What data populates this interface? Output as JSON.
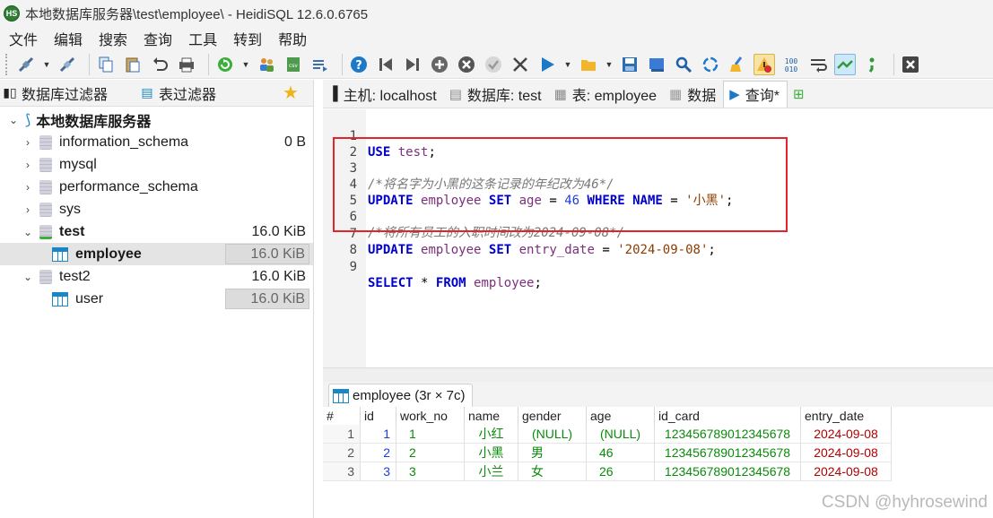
{
  "window": {
    "title": "本地数据库服务器\\test\\employee\\ - HeidiSQL 12.6.0.6765",
    "app_icon_text": "HS"
  },
  "menu": [
    "文件",
    "编辑",
    "搜索",
    "查询",
    "工具",
    "转到",
    "帮助"
  ],
  "filters": {
    "db_filter": "数据库过滤器",
    "table_filter": "表过滤器"
  },
  "tree": {
    "root": "本地数据库服务器",
    "nodes": [
      {
        "name": "information_schema",
        "size": "0 B"
      },
      {
        "name": "mysql",
        "size": ""
      },
      {
        "name": "performance_schema",
        "size": ""
      },
      {
        "name": "sys",
        "size": ""
      },
      {
        "name": "test",
        "size": "16.0 KiB"
      },
      {
        "name": "employee",
        "size": "16.0 KiB"
      },
      {
        "name": "test2",
        "size": "16.0 KiB"
      },
      {
        "name": "user",
        "size": "16.0 KiB"
      }
    ]
  },
  "tabs": {
    "host": "主机: localhost",
    "database": "数据库: test",
    "table": "表: employee",
    "data": "数据",
    "query": "查询*"
  },
  "editor": {
    "line_numbers": [
      "1",
      "2",
      "3",
      "4",
      "5",
      "6",
      "7",
      "8",
      "9"
    ],
    "comment1": "/*将名字为小黑的这条记录的年纪改为46*/",
    "comment2": "/*将所有员工的入职时间改为2024-09-08*/",
    "l1_kw": "USE",
    "l1_ident": "test",
    "l4_update": "UPDATE",
    "l4_table": "employee",
    "l4_set": "SET",
    "l4_col": "age",
    "l4_eq1": "=",
    "l4_val": "46",
    "l4_where": "WHERE",
    "l4_name": "NAME",
    "l4_eq2": "=",
    "l4_str": "'小黑'",
    "l7_update": "UPDATE",
    "l7_table": "employee",
    "l7_set": "SET",
    "l7_col": "entry_date",
    "l7_eq": "=",
    "l7_str": "'2024-09-08'",
    "l9_select": "SELECT",
    "l9_star": "*",
    "l9_from": "FROM",
    "l9_table": "employee",
    "semicolon": ";"
  },
  "result": {
    "tab_label": "employee (3r × 7c)",
    "columns": [
      "#",
      "id",
      "work_no",
      "name",
      "gender",
      "age",
      "id_card",
      "entry_date"
    ],
    "rows": [
      {
        "rownum": "1",
        "id": "1",
        "work_no": "1",
        "name": "小红",
        "gender": "(NULL)",
        "age": "(NULL)",
        "id_card": "123456789012345678",
        "entry_date": "2024-09-08"
      },
      {
        "rownum": "2",
        "id": "2",
        "work_no": "2",
        "name": "小黑",
        "gender": "男",
        "age": "46",
        "id_card": "123456789012345678",
        "entry_date": "2024-09-08"
      },
      {
        "rownum": "3",
        "id": "3",
        "work_no": "3",
        "name": "小兰",
        "gender": "女",
        "age": "26",
        "id_card": "123456789012345678",
        "entry_date": "2024-09-08"
      }
    ]
  },
  "watermark": "CSDN @hyhrosewind",
  "colors": {
    "highlight_box": "#e0262b",
    "keyword": "#0000c8",
    "date_value": "#b00000"
  }
}
